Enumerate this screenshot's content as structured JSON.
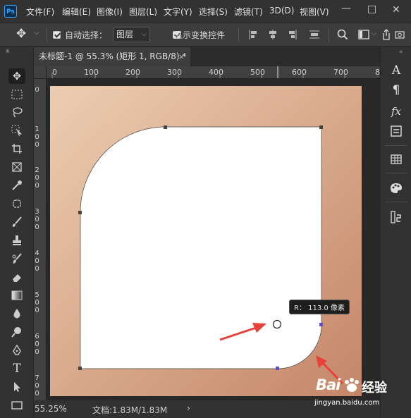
{
  "app": {
    "logo_text": "Ps"
  },
  "menu": {
    "items": [
      "文件(F)",
      "编辑(E)",
      "图像(I)",
      "图层(L)",
      "文字(Y)",
      "选择(S)",
      "滤镜(T)",
      "3D(D)",
      "视图(V)"
    ],
    "minimize": "—",
    "restore": "□",
    "close": "✕"
  },
  "options": {
    "auto_select_label": "自动选择：",
    "auto_select_value": "图层",
    "show_transform_label": "显示变换控件"
  },
  "document": {
    "tab_title": "未标题-1 @ 55.3% (矩形 1, RGB/8) *",
    "tab_close": "×"
  },
  "ruler": {
    "h_labels": [
      "0",
      "100",
      "200",
      "300",
      "400",
      "500",
      "600",
      "700",
      "8"
    ],
    "v_labels": [
      [
        "0"
      ],
      [
        "1",
        "0",
        "0"
      ],
      [
        "2",
        "0",
        "0"
      ],
      [
        "3",
        "0",
        "0"
      ],
      [
        "4",
        "0",
        "0"
      ],
      [
        "5",
        "0",
        "0"
      ],
      [
        "6",
        "0",
        "0"
      ],
      [
        "7",
        "0",
        "0"
      ],
      [
        "8",
        "0",
        "0"
      ]
    ]
  },
  "canvas": {
    "background_gradient": [
      "#e9c6a8",
      "#c68a6b"
    ],
    "shape_fill": "#ffffff",
    "radius_tooltip": "R：  113.0 像素"
  },
  "status": {
    "zoom": "55.25%",
    "doc_info": "文档:1.83M/1.83M",
    "arrow": "›"
  },
  "watermark": {
    "brand": "Bai",
    "brand_suffix": "经验",
    "url": "jingyan.baidu.com"
  },
  "colors": {
    "accent": "#31a8ff",
    "arrow_red": "#e8403a",
    "anchor": "#5b4fd8"
  }
}
